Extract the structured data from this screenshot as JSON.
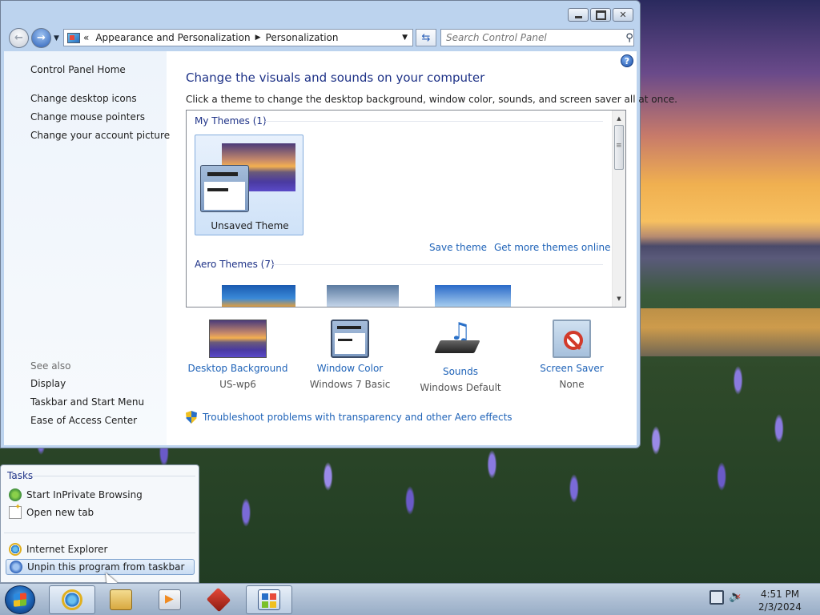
{
  "window": {
    "breadcrumb": [
      "Appearance and Personalization",
      "Personalization"
    ],
    "breadcrumb_prefix": "«",
    "search_placeholder": "Search Control Panel"
  },
  "sidebar": {
    "home": "Control Panel Home",
    "links": [
      "Change desktop icons",
      "Change mouse pointers",
      "Change your account picture"
    ],
    "see_also_label": "See also",
    "see_also": [
      "Display",
      "Taskbar and Start Menu",
      "Ease of Access Center"
    ]
  },
  "main": {
    "heading": "Change the visuals and sounds on your computer",
    "subtext": "Click a theme to change the desktop background, window color, sounds, and screen saver all at once.",
    "my_themes_header": "My Themes (1)",
    "unsaved_theme": "Unsaved Theme",
    "save_theme": "Save theme",
    "get_more": "Get more themes online",
    "aero_themes_header": "Aero Themes (7)",
    "settings": [
      {
        "label": "Desktop Background",
        "value": "US-wp6"
      },
      {
        "label": "Window Color",
        "value": "Windows 7 Basic"
      },
      {
        "label": "Sounds",
        "value": "Windows Default"
      },
      {
        "label": "Screen Saver",
        "value": "None"
      }
    ],
    "troubleshoot": "Troubleshoot problems with transparency and other Aero effects"
  },
  "jumplist": {
    "tasks_header": "Tasks",
    "tasks": [
      "Start InPrivate Browsing",
      "Open new tab"
    ],
    "program": "Internet Explorer",
    "unpin": "Unpin this program from taskbar"
  },
  "taskbar": {
    "time": "4:51 PM",
    "date": "2/3/2024"
  }
}
